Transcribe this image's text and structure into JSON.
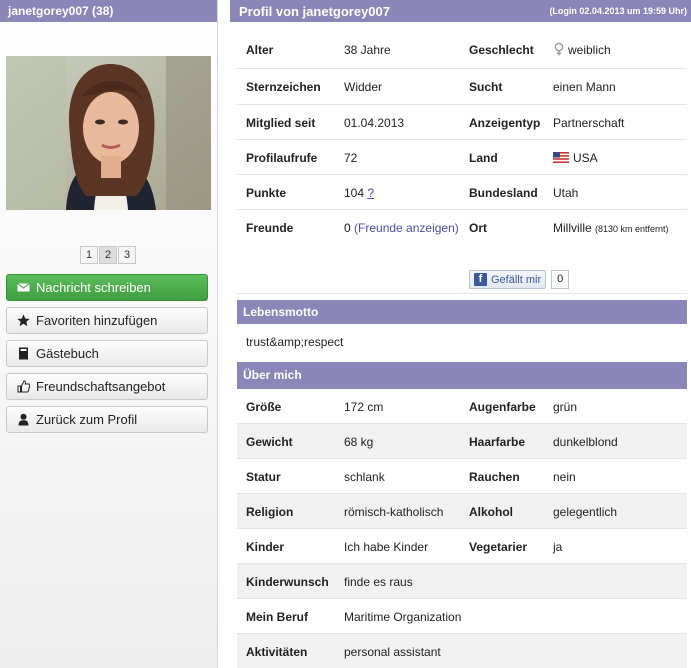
{
  "left": {
    "header": "janetgorey007 (38)",
    "pages": [
      "1",
      "2",
      "3"
    ],
    "active_page": "2",
    "buttons": {
      "message": "Nachricht schreiben",
      "favorite": "Favoriten hinzufügen",
      "guestbook": "Gästebuch",
      "friendship": "Freundschaftsangebot",
      "back": "Zurück zum Profil"
    }
  },
  "right": {
    "title": "Profil von janetgorey007",
    "login": "(Login 02.04.2013 um 19:59 Uhr)",
    "profile": {
      "alter_label": "Alter",
      "alter": "38 Jahre",
      "geschlecht_label": "Geschlecht",
      "geschlecht": "weiblich",
      "sternzeichen_label": "Sternzeichen",
      "sternzeichen": "Widder",
      "sucht_label": "Sucht",
      "sucht": "einen Mann",
      "mitglied_label": "Mitglied seit",
      "mitglied": "01.04.2013",
      "anzeigentyp_label": "Anzeigentyp",
      "anzeigentyp": "Partnerschaft",
      "profilaufrufe_label": "Profilaufrufe",
      "profilaufrufe": "72",
      "land_label": "Land",
      "land": "USA",
      "punkte_label": "Punkte",
      "punkte": "104",
      "punkte_help": "?",
      "bundesland_label": "Bundesland",
      "bundesland": "Utah",
      "freunde_label": "Freunde",
      "freunde": "0",
      "freunde_link": "(Freunde anzeigen)",
      "ort_label": "Ort",
      "ort": "Millville",
      "ort_distance": "(8130 km entfernt)"
    },
    "facebook": {
      "like": "Gefällt mir",
      "count": "0"
    },
    "lebensmotto": {
      "title": "Lebensmotto",
      "text": "trust&amp;respect"
    },
    "ueber_mich": {
      "title": "Über mich",
      "groesse_label": "Größe",
      "groesse": "172 cm",
      "augenfarbe_label": "Augenfarbe",
      "augenfarbe": "grün",
      "gewicht_label": "Gewicht",
      "gewicht": "68 kg",
      "haarfarbe_label": "Haarfarbe",
      "haarfarbe": "dunkelblond",
      "statur_label": "Statur",
      "statur": "schlank",
      "rauchen_label": "Rauchen",
      "rauchen": "nein",
      "religion_label": "Religion",
      "religion": "römisch-katholisch",
      "alkohol_label": "Alkohol",
      "alkohol": "gelegentlich",
      "kinder_label": "Kinder",
      "kinder": "Ich habe Kinder",
      "vegetarier_label": "Vegetarier",
      "vegetarier": "ja",
      "kinderwunsch_label": "Kinderwunsch",
      "kinderwunsch": "finde es raus",
      "beruf_label": "Mein Beruf",
      "beruf": "Maritime Organization",
      "aktivitaeten_label": "Aktivitäten",
      "aktivitaeten": "personal assistant"
    }
  },
  "colors": {
    "header": "#8a86b8",
    "green_button": "#4caf50",
    "link": "#4a4fb0",
    "facebook": "#3b5998"
  }
}
